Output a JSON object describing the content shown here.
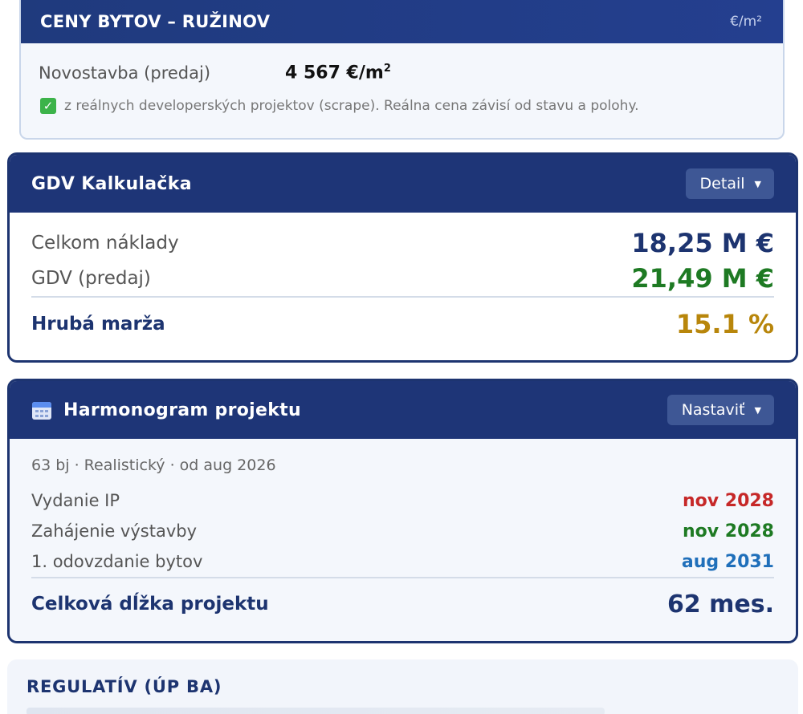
{
  "prices": {
    "title": "CENY BYTOV – RUŽINOV",
    "unit": "€/m²",
    "row_label": "Novostavba (predaj)",
    "row_value": "4 567 €/m",
    "row_value_sup": "2",
    "note": "z reálnych developerských projektov (scrape). Reálna cena závisí od stavu a polohy."
  },
  "gdv": {
    "title": "GDV Kalkulačka",
    "button_label": "Detail",
    "rows": [
      {
        "label": "Celkom náklady",
        "value": "18,25 M €",
        "color": "#1d3470"
      },
      {
        "label": "GDV (predaj)",
        "value": "21,49 M €",
        "color": "#1e7a23"
      }
    ],
    "total_label": "Hrubá marža",
    "total_value": "15.1 %",
    "total_color": "#b8860b"
  },
  "harmonogram": {
    "title": "Harmonogram projektu",
    "button_label": "Nastaviť",
    "subtitle": "63 bj · Realistický · od aug 2026",
    "rows": [
      {
        "label": "Vydanie IP",
        "value": "nov 2028",
        "color": "#c62828"
      },
      {
        "label": "Zahájenie výstavby",
        "value": "nov 2028",
        "color": "#1e7a23"
      },
      {
        "label": "1. odovzdanie bytov",
        "value": "aug 2031",
        "color": "#1f6fba"
      }
    ],
    "total_label": "Celková dĺžka projektu",
    "total_value": "62 mes."
  },
  "regulativ": {
    "title": "REGULATÍV (ÚP BA)"
  },
  "icons": {
    "check": "check-icon",
    "calendar": "calendar-icon",
    "caret": "caret-down-icon"
  }
}
